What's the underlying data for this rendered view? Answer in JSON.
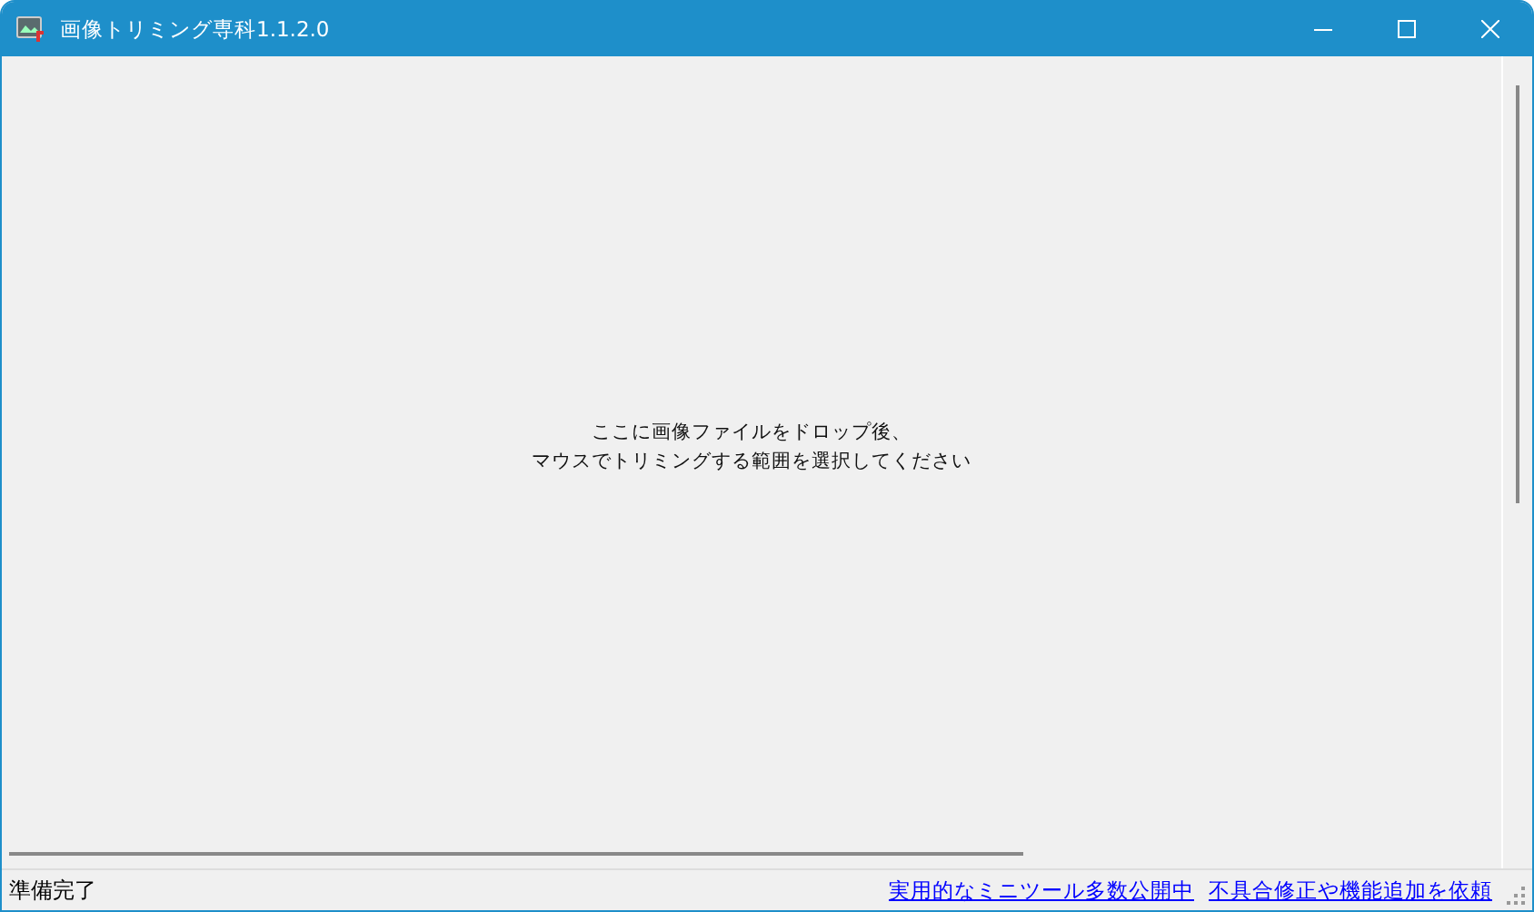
{
  "window": {
    "title": "画像トリミング専科1.1.2.0"
  },
  "canvas": {
    "message": [
      "ここに画像ファイルをドロップ後、",
      "マウスでトリミングする範囲を選択してください"
    ]
  },
  "status_bar": {
    "text": "準備完了",
    "links": [
      "実用的なミニツール多数公開中",
      "不具合修正や機能追加を依頼"
    ]
  }
}
